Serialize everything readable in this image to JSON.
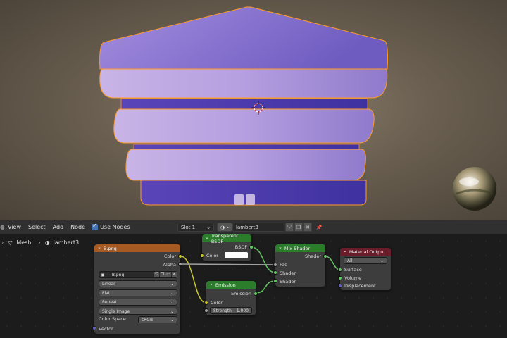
{
  "header": {
    "menus": [
      "View",
      "Select",
      "Add",
      "Node"
    ],
    "use_nodes": "Use Nodes",
    "slot": "Slot 1",
    "material": "lambert3"
  },
  "breadcrumb": {
    "mesh": "Mesh",
    "material": "lambert3"
  },
  "nodes": {
    "image": {
      "title": "B.png",
      "out_color": "Color",
      "out_alpha": "Alpha",
      "file": "B.png",
      "interpolation": "Linear",
      "projection": "Flat",
      "extension": "Repeat",
      "source": "Single Image",
      "color_space_label": "Color Space",
      "color_space": "sRGB",
      "in_vector": "Vector"
    },
    "transparent": {
      "title": "Transparent BSDF",
      "out_bsdf": "BSDF",
      "in_color": "Color"
    },
    "emission": {
      "title": "Emission",
      "out_emission": "Emission",
      "in_color": "Color",
      "strength_label": "Strength",
      "strength_value": "1.000"
    },
    "mix": {
      "title": "Mix Shader",
      "out_shader": "Shader",
      "in_fac": "Fac",
      "in_shader1": "Shader",
      "in_shader2": "Shader"
    },
    "output": {
      "title": "Material Output",
      "target": "All",
      "in_surface": "Surface",
      "in_volume": "Volume",
      "in_displacement": "Displacement"
    }
  },
  "colors": {
    "image_header": "#a65a22",
    "shader_header": "#2b7d2b",
    "output_header": "#6b1c2b",
    "selection_outline": "#ff9a2a",
    "mesh_purple": "#7d63c4"
  }
}
